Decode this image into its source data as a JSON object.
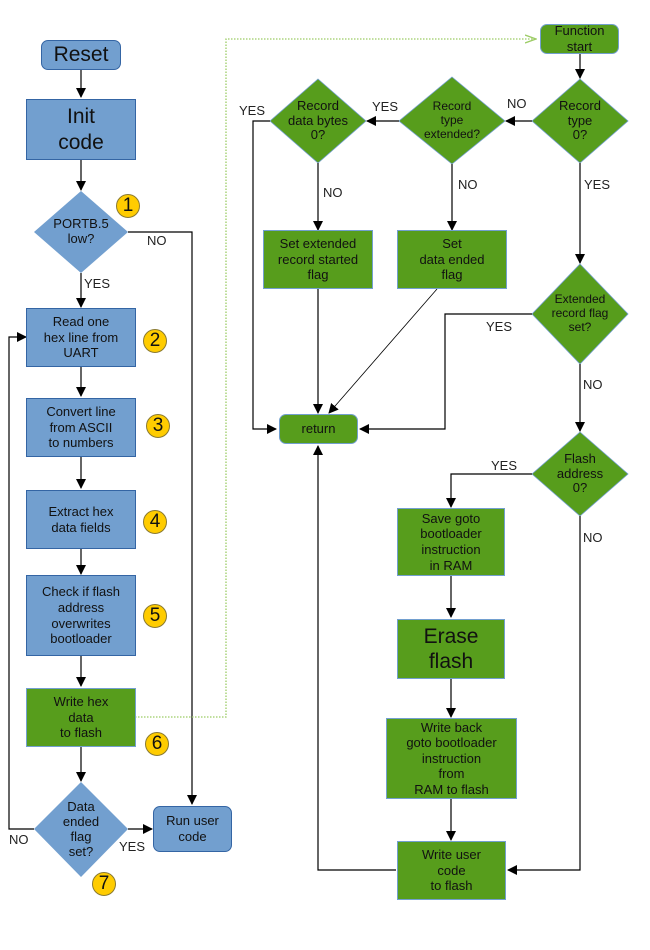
{
  "colors": {
    "blue_fill": "#729fcf",
    "green_fill": "#579d1c",
    "badge_fill": "#ffcc00",
    "dotted_link": "#9ccc65",
    "line": "#000000"
  },
  "left_flow": {
    "reset": "Reset",
    "init": "Init\ncode",
    "portb": "PORTB.5\nlow?",
    "read_line": "Read one\nhex line from\nUART",
    "convert": "Convert line\nfrom ASCII\nto numbers",
    "extract": "Extract hex\ndata fields",
    "check": "Check if flash\naddress\noverwrites\nbootloader",
    "write_hex": "Write hex\ndata\nto flash",
    "data_ended": "Data\nended\nflag\nset?",
    "run_user": "Run user\ncode",
    "labels": {
      "portb_no": "NO",
      "portb_yes": "YES",
      "data_ended_no": "NO",
      "data_ended_yes": "YES"
    },
    "badges": [
      "1",
      "2",
      "3",
      "4",
      "5",
      "6",
      "7"
    ]
  },
  "right_flow": {
    "function_start": "Function\nstart",
    "record_type0": "Record\ntype\n0?",
    "record_type_ext": "Record\ntype\nextended?",
    "record_data_bytes": "Record\ndata bytes\n0?",
    "set_ext_flag": "Set extended\nrecord started\nflag",
    "set_data_ended": "Set\ndata ended\nflag",
    "return": "return",
    "ext_flag_set": "Extended\nrecord flag\nset?",
    "flash_addr0": "Flash\naddress\n0?",
    "save_goto": "Save goto\nbootloader\ninstruction\nin RAM",
    "erase_flash": "Erase\nflash",
    "write_back": "Write back\ngoto bootloader\ninstruction\nfrom\nRAM to flash",
    "write_user": "Write user\ncode\nto flash",
    "labels": {
      "rt0_no": "NO",
      "rt0_yes": "YES",
      "rtext_yes": "YES",
      "rtext_no": "NO",
      "rdb_yes": "YES",
      "rdb_no": "NO",
      "ext_yes": "YES",
      "ext_no": "NO",
      "fa_yes": "YES",
      "fa_no": "NO"
    }
  }
}
